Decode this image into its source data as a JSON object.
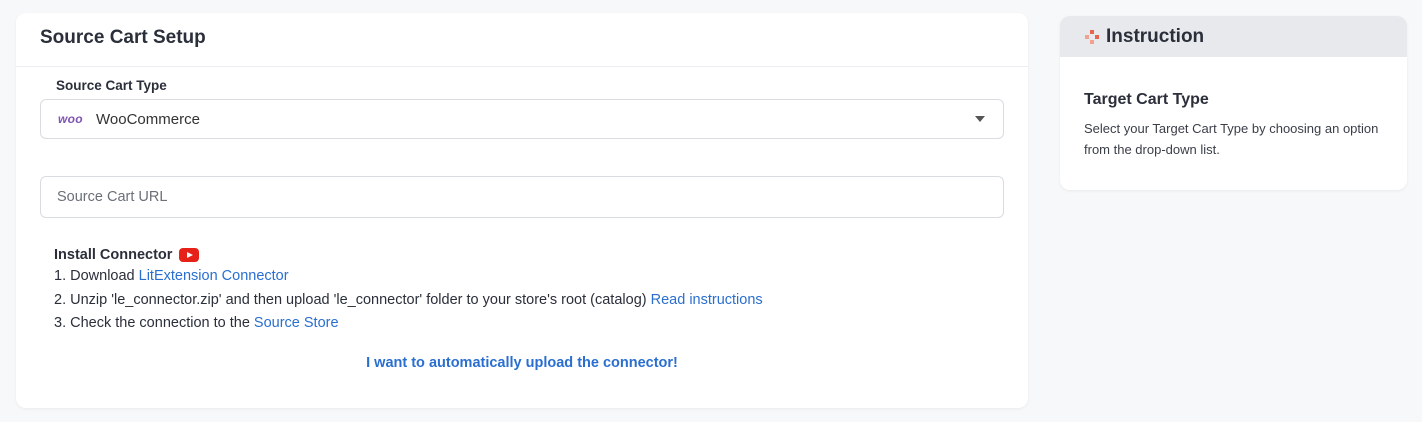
{
  "main": {
    "title": "Source Cart Setup",
    "cart_type_label": "Source Cart Type",
    "cart_type_logo": "woo",
    "cart_type_value": "WooCommerce",
    "url_placeholder": "Source Cart URL",
    "url_value": ""
  },
  "connector": {
    "title": "Install Connector",
    "steps": [
      {
        "prefix": "1. Download ",
        "link": "LitExtension Connector",
        "suffix": ""
      },
      {
        "prefix": "2. Unzip 'le_connector.zip' and then upload 'le_connector' folder to your store's root (catalog) ",
        "link": "Read instructions",
        "suffix": ""
      },
      {
        "prefix": "3. Check the connection to the ",
        "link": "Source Store",
        "suffix": ""
      }
    ],
    "auto_upload_label": "I want to automatically upload the connector!"
  },
  "instruction": {
    "title": "Instruction",
    "heading": "Target Cart Type",
    "text": "Select your Target Cart Type by choosing an option from the drop-down list."
  },
  "colors": {
    "link": "#2a6fd0",
    "woo_brand": "#7f54b3",
    "youtube": "#e62117",
    "instruction_icon": "#e8664f"
  },
  "icons": {
    "instruction": "puzzle-dots-icon",
    "video": "youtube-icon",
    "dropdown": "caret-down-icon"
  }
}
